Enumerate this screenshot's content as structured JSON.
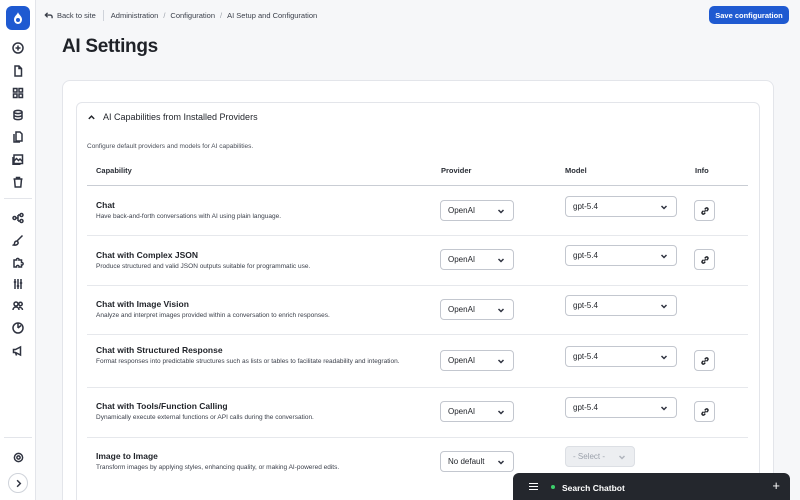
{
  "breadcrumb": {
    "back_label": "Back to site",
    "items": [
      "Administration",
      "Configuration",
      "AI Setup and Configuration"
    ]
  },
  "header": {
    "save_label": "Save configuration",
    "page_title": "AI Settings"
  },
  "section": {
    "title": "AI Capabilities from Installed Providers",
    "description": "Configure default providers and models for AI capabilities."
  },
  "table": {
    "columns": [
      "Capability",
      "Provider",
      "Model",
      "Info"
    ],
    "rows": [
      {
        "name": "Chat",
        "description": "Have back-and-forth conversations with AI using plain language.",
        "provider": "OpenAI",
        "model": "gpt-5.4"
      },
      {
        "name": "Chat with Complex JSON",
        "description": "Produce structured and valid JSON outputs suitable for programmatic use.",
        "provider": "OpenAI",
        "model": "gpt-5.4"
      },
      {
        "name": "Chat with Image Vision",
        "description": "Analyze and interpret images provided within a conversation to enrich responses.",
        "provider": "OpenAI",
        "model": "gpt-5.4"
      },
      {
        "name": "Chat with Structured Response",
        "description": "Format responses into predictable structures such as lists or tables to facilitate readability and integration.",
        "provider": "OpenAI",
        "model": "gpt-5.4"
      },
      {
        "name": "Chat with Tools/Function Calling",
        "description": "Dynamically execute external functions or API calls during the conversation.",
        "provider": "OpenAI",
        "model": "gpt-5.4"
      },
      {
        "name": "Image to Image",
        "description": "Transform images by applying styles, enhancing quality, or making AI-powered edits.",
        "provider": "No default",
        "model": "- Select -"
      }
    ]
  },
  "chatbot": {
    "label": "Search Chatbot",
    "plus": "+"
  },
  "colors": {
    "accent": "#1f5ad1",
    "status_online": "#3ccf6b",
    "chatbot_bg": "#24272d"
  },
  "icons": {
    "sidebar": [
      "drupal-logo-icon",
      "add-circle-icon",
      "content-icon",
      "blocks-icon",
      "database-icon",
      "files-icon",
      "media-icon",
      "trash-icon",
      "structure-icon",
      "appearance-icon",
      "extend-icon",
      "config-icon",
      "people-icon",
      "reports-icon",
      "announcements-icon",
      "help-icon",
      "expand-icon"
    ]
  }
}
